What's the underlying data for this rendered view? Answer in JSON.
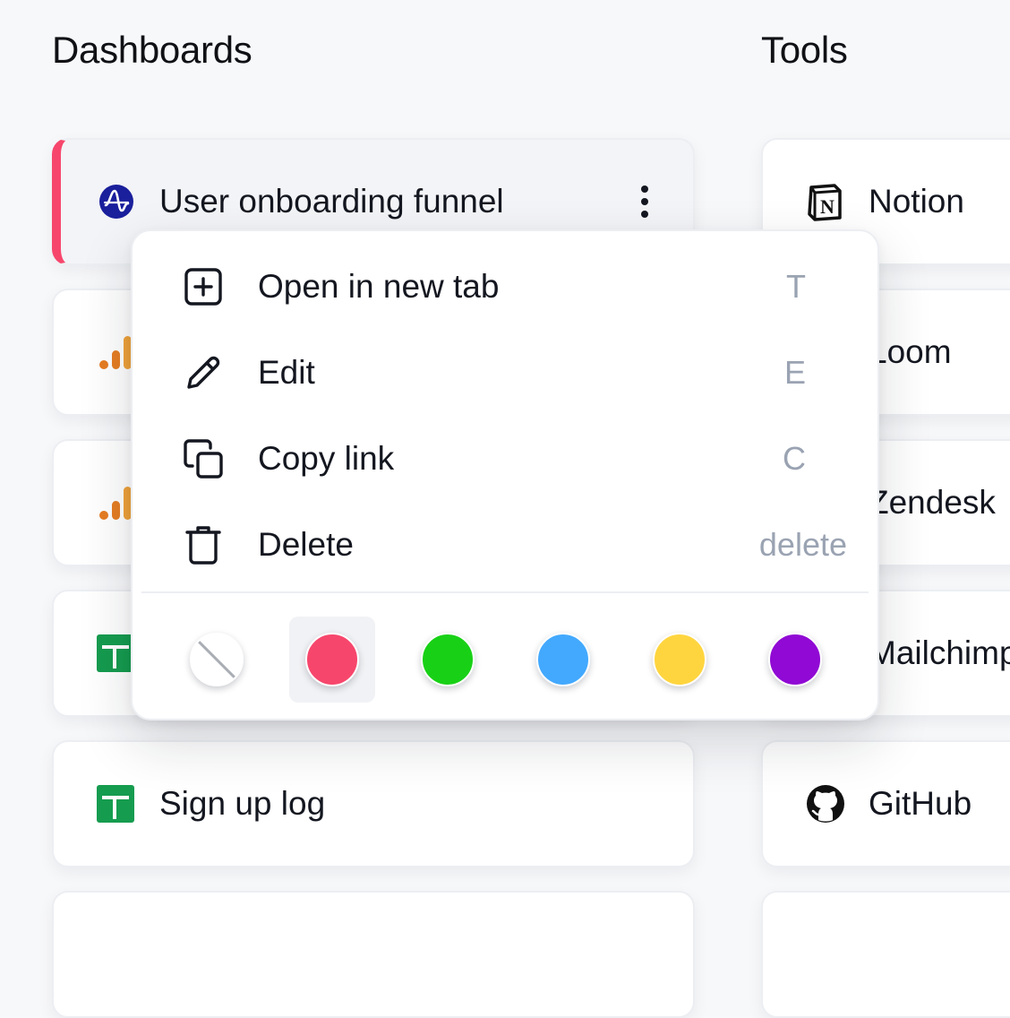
{
  "sections": {
    "dashboards_title": "Dashboards",
    "tools_title": "Tools"
  },
  "dashboards": [
    {
      "label": "User onboarding funnel",
      "icon": "amplitude-icon",
      "active": true
    },
    {
      "label": "",
      "icon": "analytics-bars-icon"
    },
    {
      "label": "",
      "icon": "analytics-bars-icon"
    },
    {
      "label": "",
      "icon": "google-sheets-icon"
    },
    {
      "label": "Sign up log",
      "icon": "google-sheets-icon"
    }
  ],
  "tools": [
    {
      "label": "Notion",
      "icon": "notion-icon"
    },
    {
      "label": "Loom",
      "icon": "loom-icon"
    },
    {
      "label": "Zendesk",
      "icon": "zendesk-icon"
    },
    {
      "label": "Mailchimp",
      "icon": "mailchimp-icon"
    },
    {
      "label": "GitHub",
      "icon": "github-icon"
    }
  ],
  "context_menu": {
    "items": [
      {
        "label": "Open in new tab",
        "shortcut": "T",
        "icon": "plus-square-icon"
      },
      {
        "label": "Edit",
        "shortcut": "E",
        "icon": "pencil-icon"
      },
      {
        "label": "Copy link",
        "shortcut": "C",
        "icon": "copy-icon"
      },
      {
        "label": "Delete",
        "shortcut": "delete",
        "icon": "trash-icon"
      }
    ],
    "colors": [
      {
        "name": "none",
        "hex": "#ffffff"
      },
      {
        "name": "red",
        "hex": "#f7466c",
        "selected": true
      },
      {
        "name": "green",
        "hex": "#18d116"
      },
      {
        "name": "blue",
        "hex": "#43a9ff"
      },
      {
        "name": "yellow",
        "hex": "#ffd53f"
      },
      {
        "name": "purple",
        "hex": "#9009d4"
      }
    ]
  },
  "colors": {
    "accent_active": "#f7466c",
    "amplitude_blue": "#1a1f9c",
    "analytics_orange": "#e67d22",
    "sheets_green": "#159c4f",
    "shortcut_gray": "#9aa3b2"
  }
}
